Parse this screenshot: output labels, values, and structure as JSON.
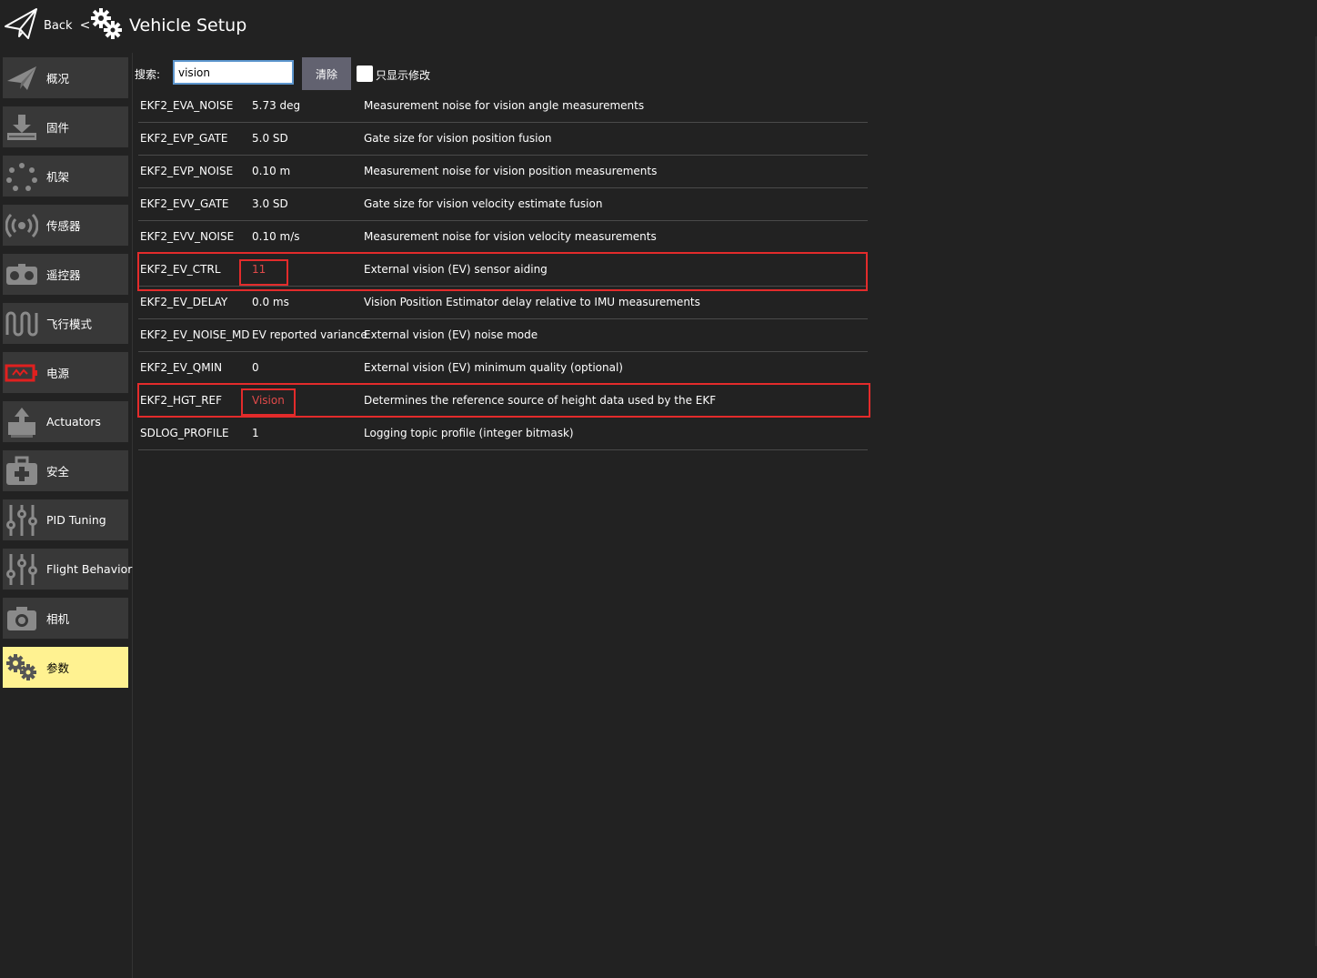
{
  "header": {
    "back_label": "Back",
    "chevron": "<",
    "title": "Vehicle Setup",
    "back_icon": "paper-plane-icon",
    "title_icon": "gears-icon"
  },
  "sidebar": {
    "items": [
      {
        "label": "概况",
        "icon": "plane-icon"
      },
      {
        "label": "固件",
        "icon": "download-icon"
      },
      {
        "label": "机架",
        "icon": "airframe-icon"
      },
      {
        "label": "传感器",
        "icon": "sensors-icon"
      },
      {
        "label": "遥控器",
        "icon": "radio-icon"
      },
      {
        "label": "飞行模式",
        "icon": "flight-modes-icon"
      },
      {
        "label": "电源",
        "icon": "battery-icon"
      },
      {
        "label": "Actuators",
        "icon": "actuators-icon"
      },
      {
        "label": "安全",
        "icon": "safety-kit-icon"
      },
      {
        "label": "PID Tuning",
        "icon": "sliders-icon"
      },
      {
        "label": "Flight Behavior",
        "icon": "sliders-icon"
      },
      {
        "label": "相机",
        "icon": "camera-icon"
      },
      {
        "label": "参数",
        "icon": "gears-icon"
      }
    ],
    "active_index": 12
  },
  "search": {
    "label": "搜索:",
    "value": "vision",
    "clear_label": "清除",
    "show_modified_label": "只显示修改",
    "show_modified_checked": false
  },
  "params": [
    {
      "name": "EKF2_EVA_NOISE",
      "value": "5.73 deg",
      "description": "Measurement noise for vision angle measurements"
    },
    {
      "name": "EKF2_EVP_GATE",
      "value": "5.0 SD",
      "description": "Gate size for vision position fusion"
    },
    {
      "name": "EKF2_EVP_NOISE",
      "value": "0.10 m",
      "description": "Measurement noise for vision position measurements"
    },
    {
      "name": "EKF2_EVV_GATE",
      "value": "3.0 SD",
      "description": "Gate size for vision velocity estimate fusion"
    },
    {
      "name": "EKF2_EVV_NOISE",
      "value": "0.10 m/s",
      "description": "Measurement noise for vision velocity measurements"
    },
    {
      "name": "EKF2_EV_CTRL",
      "value": "11",
      "description": "External vision (EV) sensor aiding",
      "highlighted": true
    },
    {
      "name": "EKF2_EV_DELAY",
      "value": "0.0 ms",
      "description": "Vision Position Estimator delay relative to IMU measurements"
    },
    {
      "name": "EKF2_EV_NOISE_MD",
      "value": "EV reported variance",
      "description": "External vision (EV) noise mode"
    },
    {
      "name": "EKF2_EV_QMIN",
      "value": "0",
      "description": "External vision (EV) minimum quality (optional)"
    },
    {
      "name": "EKF2_HGT_REF",
      "value": "Vision",
      "description": "Determines the reference source of height data used by the EKF",
      "highlighted": true
    },
    {
      "name": "SDLOG_PROFILE",
      "value": "1",
      "description": "Logging topic profile (integer bitmask)"
    }
  ],
  "colors": {
    "background": "#222222",
    "sidebar_item": "#383838",
    "active_item": "#fff291",
    "highlight_box": "#e32b2b",
    "modified_value": "#e04a4a",
    "clear_button": "#626270"
  }
}
